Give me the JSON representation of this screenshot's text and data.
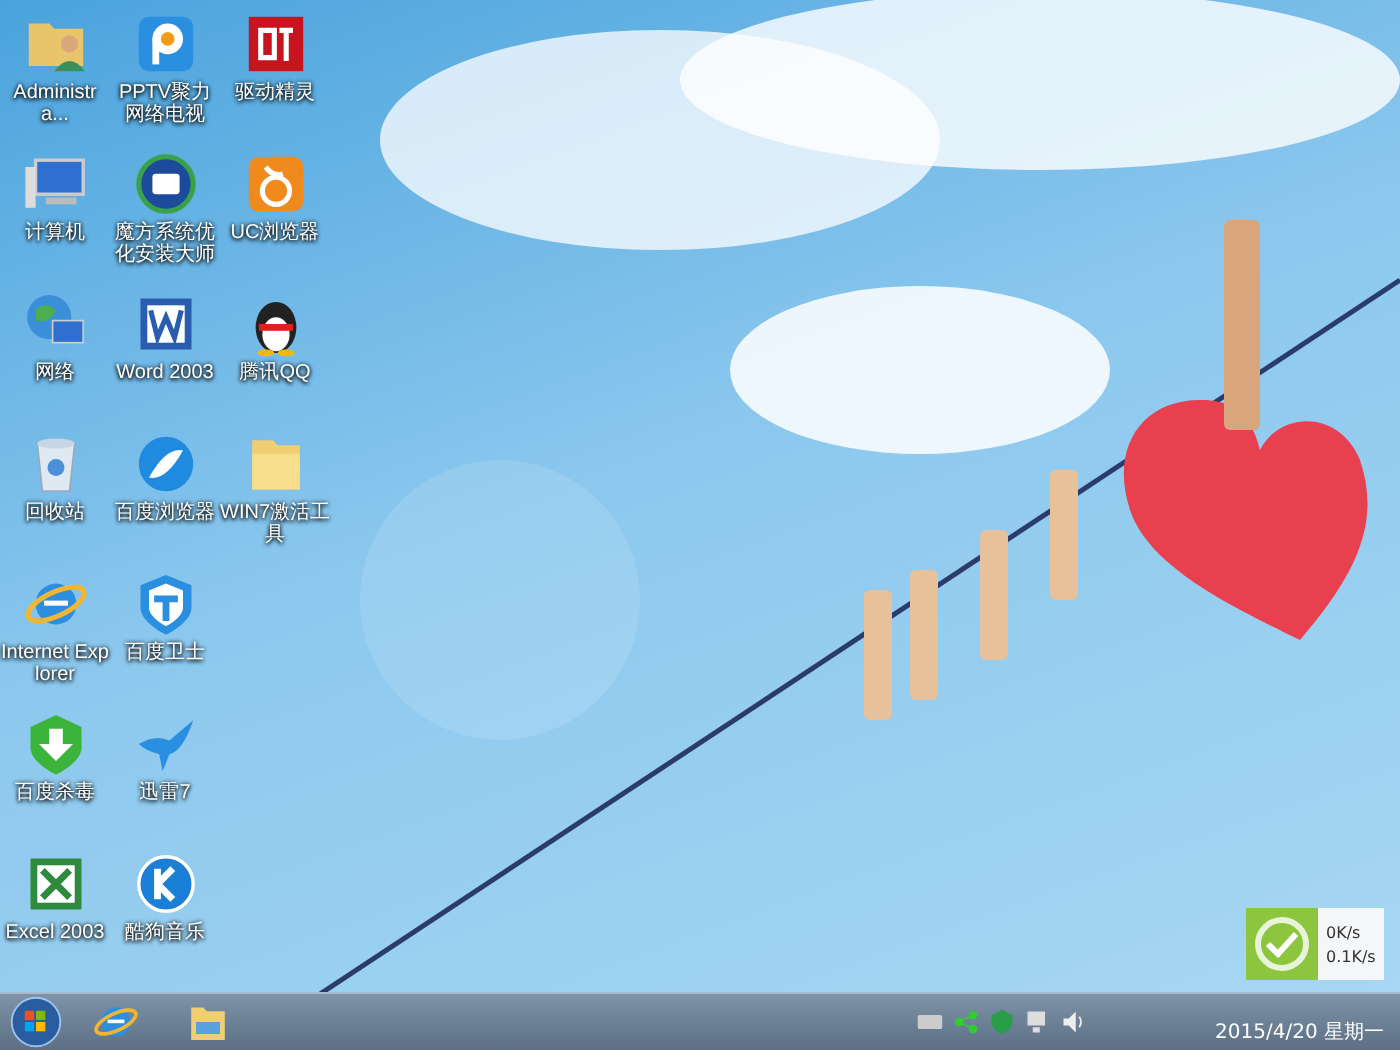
{
  "desktop": {
    "icon_columns": [
      [
        {
          "label": "Administra...",
          "kind": "user-folder"
        },
        {
          "label": "计算机",
          "kind": "computer"
        },
        {
          "label": "网络",
          "kind": "network"
        },
        {
          "label": "回收站",
          "kind": "recycle"
        },
        {
          "label": "Internet Explorer",
          "kind": "ie"
        },
        {
          "label": "百度杀毒",
          "kind": "download-shield"
        },
        {
          "label": "Excel 2003",
          "kind": "excel"
        }
      ],
      [
        {
          "label": "PPTV聚力网络电视",
          "kind": "pptv"
        },
        {
          "label": "魔方系统优化安装大师",
          "kind": "mofang"
        },
        {
          "label": "Word 2003",
          "kind": "word"
        },
        {
          "label": "百度浏览器",
          "kind": "globe"
        },
        {
          "label": "百度卫士",
          "kind": "shield"
        },
        {
          "label": "迅雷7",
          "kind": "bird"
        },
        {
          "label": "酷狗音乐",
          "kind": "kugou"
        }
      ],
      [
        {
          "label": "驱动精灵",
          "kind": "driver"
        },
        {
          "label": "UC浏览器",
          "kind": "uc"
        },
        {
          "label": "腾讯QQ",
          "kind": "penguin"
        },
        {
          "label": "WIN7激活工具",
          "kind": "folder"
        }
      ]
    ]
  },
  "speed_widget": {
    "upload": "0K/s",
    "download": "0.1K/s"
  },
  "taskbar": {
    "pinned": [
      {
        "kind": "ie"
      },
      {
        "kind": "explorer"
      }
    ],
    "date": "2015/4/20 星期一"
  }
}
